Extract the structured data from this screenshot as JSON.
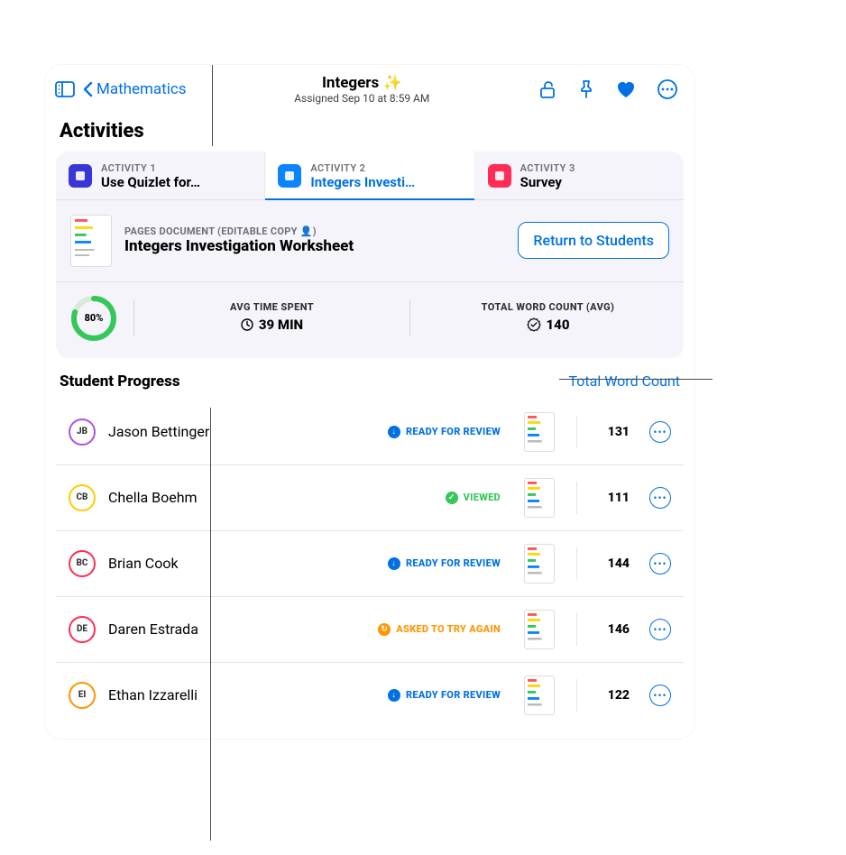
{
  "header": {
    "back_label": "Mathematics",
    "title": "Integers ✨",
    "subtitle": "Assigned Sep 10 at 8:59 AM"
  },
  "section_title": "Activities",
  "tabs": [
    {
      "caption": "ACTIVITY 1",
      "name": "Use Quizlet for…",
      "icon_color": "#3a36d6"
    },
    {
      "caption": "ACTIVITY 2",
      "name": "Integers Investi…",
      "icon_color": "#0a84ff"
    },
    {
      "caption": "ACTIVITY 3",
      "name": "Survey",
      "icon_color": "#ff2d55"
    }
  ],
  "active_tab_index": 1,
  "document": {
    "caption": "PAGES DOCUMENT (EDITABLE COPY 👤)",
    "title": "Integers Investigation Worksheet",
    "return_button": "Return to Students"
  },
  "stats": {
    "progress_pct": "80%",
    "progress_value": 80,
    "time_caption": "AVG TIME SPENT",
    "time_value": "39 MIN",
    "words_caption": "TOTAL WORD COUNT (AVG)",
    "words_value": "140"
  },
  "progress_header": {
    "title": "Student Progress",
    "link": "Total Word Count"
  },
  "status_labels": {
    "ready": "READY FOR REVIEW",
    "viewed": "VIEWED",
    "retry": "ASKED TO TRY AGAIN"
  },
  "students": [
    {
      "initials": "JB",
      "name": "Jason Bettinger",
      "ring": "#af52de",
      "status": "ready",
      "count": "131"
    },
    {
      "initials": "CB",
      "name": "Chella Boehm",
      "ring": "#ffcc00",
      "status": "viewed",
      "count": "111"
    },
    {
      "initials": "BC",
      "name": "Brian Cook",
      "ring": "#ff2d55",
      "status": "ready",
      "count": "144"
    },
    {
      "initials": "DE",
      "name": "Daren Estrada",
      "ring": "#ff2d55",
      "status": "retry",
      "count": "146"
    },
    {
      "initials": "EI",
      "name": "Ethan Izzarelli",
      "ring": "#ff9500",
      "status": "ready",
      "count": "122"
    }
  ],
  "status_styles": {
    "ready": {
      "color": "#0071e3",
      "glyph": "↓"
    },
    "viewed": {
      "color": "#34c759",
      "glyph": "✓"
    },
    "retry": {
      "color": "#ff9500",
      "glyph": "↻"
    }
  }
}
